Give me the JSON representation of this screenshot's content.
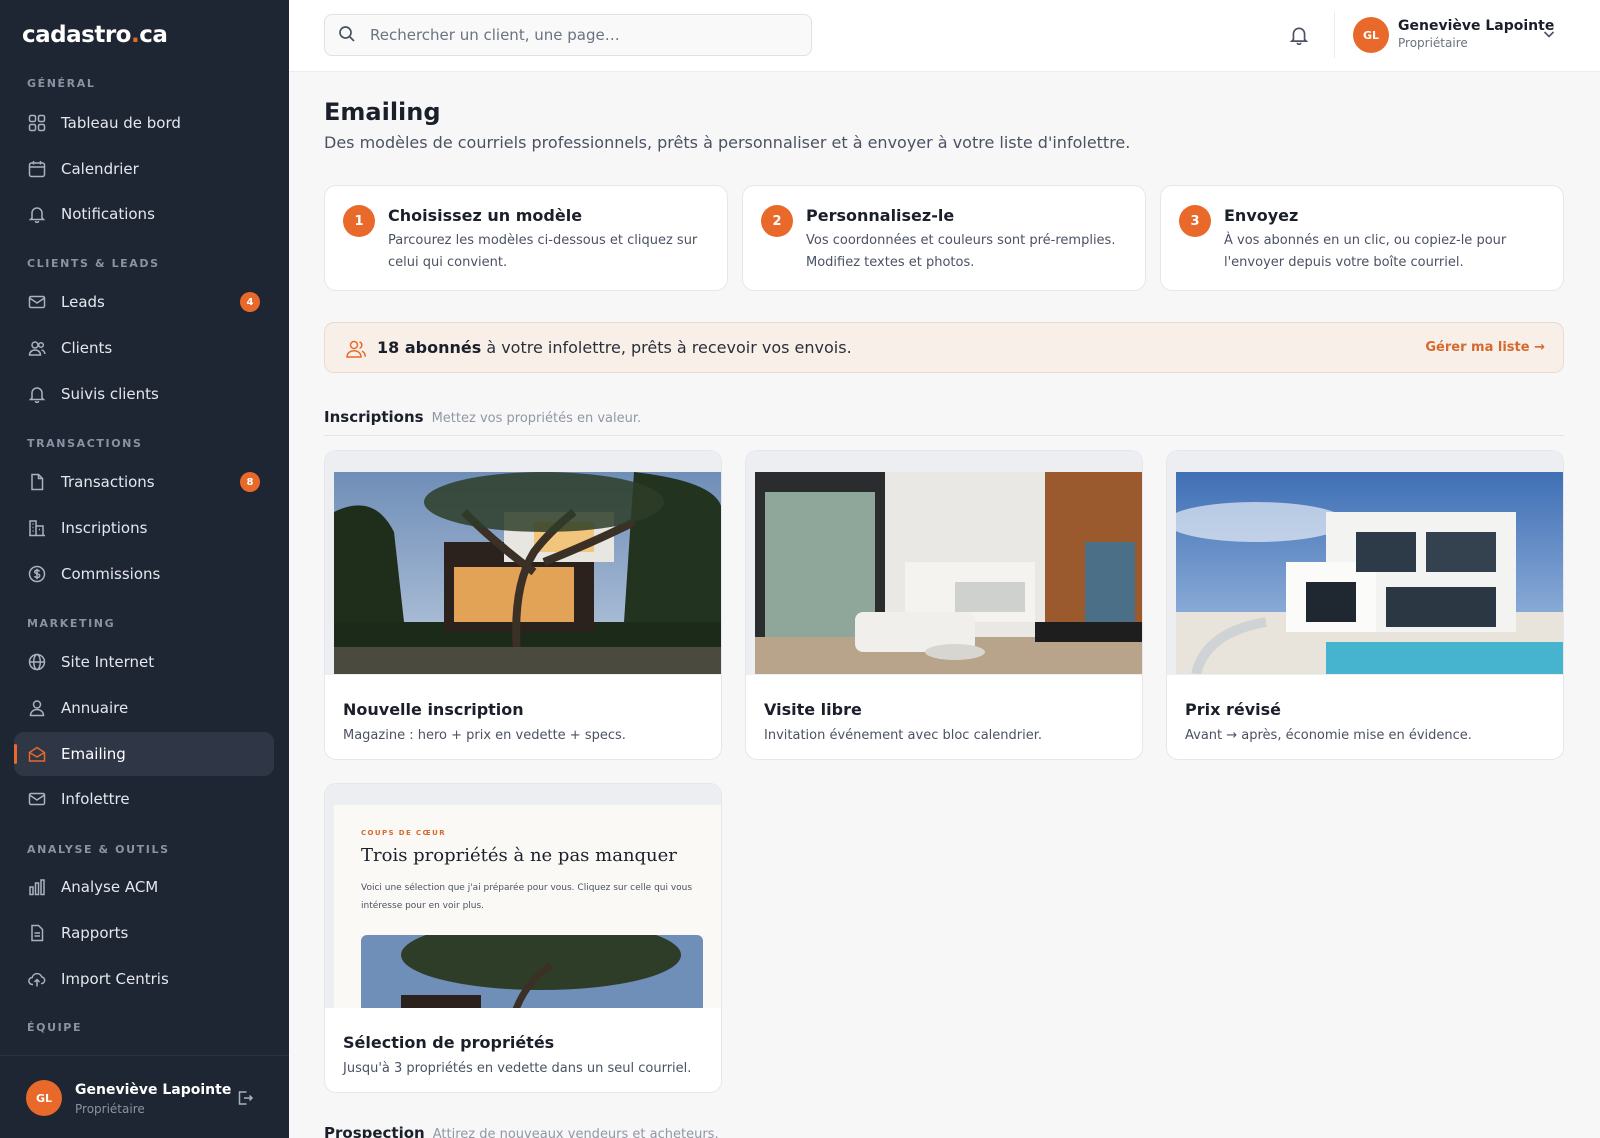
{
  "brand": {
    "name": "cadastro",
    "dot": ".",
    "tld": "ca"
  },
  "sidebar": {
    "sections": [
      {
        "title": "GÉNÉRAL",
        "items": [
          {
            "label": "Tableau de bord",
            "icon": "dashboard-icon"
          },
          {
            "label": "Calendrier",
            "icon": "calendar-icon"
          },
          {
            "label": "Notifications",
            "icon": "bell-icon"
          }
        ]
      },
      {
        "title": "CLIENTS & LEADS",
        "items": [
          {
            "label": "Leads",
            "icon": "mail-icon",
            "badge": "4"
          },
          {
            "label": "Clients",
            "icon": "users-icon"
          },
          {
            "label": "Suivis clients",
            "icon": "bell-icon"
          }
        ]
      },
      {
        "title": "TRANSACTIONS",
        "items": [
          {
            "label": "Transactions",
            "icon": "document-icon",
            "badge": "8"
          },
          {
            "label": "Inscriptions",
            "icon": "building-icon"
          },
          {
            "label": "Commissions",
            "icon": "dollar-icon"
          }
        ]
      },
      {
        "title": "MARKETING",
        "items": [
          {
            "label": "Site Internet",
            "icon": "globe-icon"
          },
          {
            "label": "Annuaire",
            "icon": "user-icon"
          },
          {
            "label": "Emailing",
            "icon": "mail-open-icon",
            "active": true
          },
          {
            "label": "Infolettre",
            "icon": "mail-icon"
          }
        ]
      },
      {
        "title": "ANALYSE & OUTILS",
        "items": [
          {
            "label": "Analyse ACM",
            "icon": "bar-chart-icon"
          },
          {
            "label": "Rapports",
            "icon": "report-icon"
          },
          {
            "label": "Import Centris",
            "icon": "cloud-upload-icon"
          }
        ]
      },
      {
        "title": "ÉQUIPE",
        "items": []
      }
    ],
    "user": {
      "initials": "GL",
      "name": "Geneviève Lapointe",
      "role": "Propriétaire"
    }
  },
  "topbar": {
    "search_placeholder": "Rechercher un client, une page…",
    "user": {
      "initials": "GL",
      "name": "Geneviève Lapointe",
      "role": "Propriétaire"
    }
  },
  "page": {
    "title": "Emailing",
    "subtitle": "Des modèles de courriels professionnels, prêts à personnaliser et à envoyer à votre liste d'infolettre."
  },
  "steps": [
    {
      "num": "1",
      "title": "Choisissez un modèle",
      "desc": "Parcourez les modèles ci-dessous et cliquez sur celui qui convient."
    },
    {
      "num": "2",
      "title": "Personnalisez-le",
      "desc": "Vos coordonnées et couleurs sont pré-remplies. Modifiez textes et photos."
    },
    {
      "num": "3",
      "title": "Envoyez",
      "desc": "À vos abonnés en un clic, ou copiez-le pour l'envoyer depuis votre boîte courriel."
    }
  ],
  "subscribers": {
    "count_label": "18 abonnés",
    "text": " à votre infolettre, prêts à recevoir vos envois.",
    "manage_label": "Gérer ma liste →"
  },
  "sections": {
    "inscriptions": {
      "title": "Inscriptions",
      "subtitle": "Mettez vos propriétés en valeur."
    },
    "prospection": {
      "title": "Prospection",
      "subtitle": "Attirez de nouveaux vendeurs et acheteurs."
    }
  },
  "templates": [
    {
      "title": "Nouvelle inscription",
      "desc": "Magazine : hero + prix en vedette + specs."
    },
    {
      "title": "Visite libre",
      "desc": "Invitation événement avec bloc calendrier."
    },
    {
      "title": "Prix révisé",
      "desc": "Avant → après, économie mise en évidence."
    },
    {
      "title": "Sélection de propriétés",
      "desc": "Jusqu'à 3 propriétés en vedette dans un seul courriel.",
      "preview": {
        "eyebrow": "COUPS DE CŒUR",
        "title": "Trois propriétés à ne pas manquer",
        "body": "Voici une sélection que j'ai préparée pour vous. Cliquez sur celle qui vous intéresse pour en voir plus."
      }
    }
  ],
  "colors": {
    "accent": "#e8692a",
    "sidebar_bg": "#1e2533",
    "banner_bg": "#f8efe9"
  }
}
